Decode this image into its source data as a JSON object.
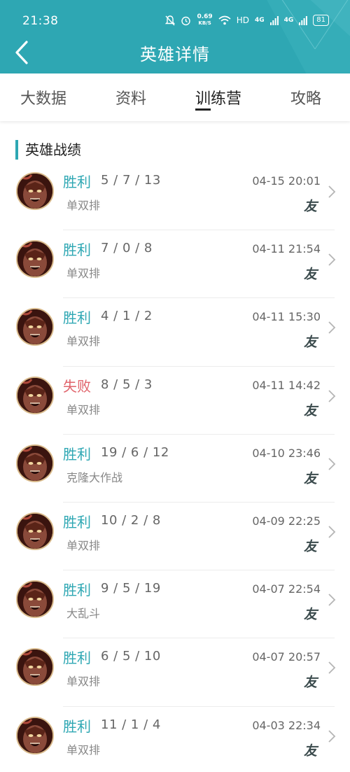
{
  "status": {
    "time": "21:38",
    "net_speed": "0.69",
    "net_unit": "KB/S",
    "hd": "HD",
    "sig1": "4G",
    "sig2": "4G",
    "battery": "81"
  },
  "header": {
    "title": "英雄详情"
  },
  "tabs": [
    {
      "label": "大数据",
      "active": false
    },
    {
      "label": "资料",
      "active": false
    },
    {
      "label": "训练营",
      "active": true
    },
    {
      "label": "攻略",
      "active": false
    }
  ],
  "section": {
    "title": "英雄战绩"
  },
  "colors": {
    "accent": "#2ea7b3",
    "win": "#2ea7b3",
    "lose": "#e0636b"
  },
  "matches": [
    {
      "result": "胜利",
      "kda": "5 / 7 / 13",
      "mode": "单双排",
      "time": "04-15 20:01",
      "tag": "友"
    },
    {
      "result": "胜利",
      "kda": "7 / 0 / 8",
      "mode": "单双排",
      "time": "04-11 21:54",
      "tag": "友"
    },
    {
      "result": "胜利",
      "kda": "4 / 1 / 2",
      "mode": "单双排",
      "time": "04-11 15:30",
      "tag": "友"
    },
    {
      "result": "失败",
      "kda": "8 / 5 / 3",
      "mode": "单双排",
      "time": "04-11 14:42",
      "tag": "友"
    },
    {
      "result": "胜利",
      "kda": "19 / 6 / 12",
      "mode": "克隆大作战",
      "time": "04-10 23:46",
      "tag": "友"
    },
    {
      "result": "胜利",
      "kda": "10 / 2 / 8",
      "mode": "单双排",
      "time": "04-09 22:25",
      "tag": "友"
    },
    {
      "result": "胜利",
      "kda": "9 / 5 / 19",
      "mode": "大乱斗",
      "time": "04-07 22:54",
      "tag": "友"
    },
    {
      "result": "胜利",
      "kda": "6 / 5 / 10",
      "mode": "单双排",
      "time": "04-07 20:57",
      "tag": "友"
    },
    {
      "result": "胜利",
      "kda": "11 / 1 / 4",
      "mode": "单双排",
      "time": "04-03 22:34",
      "tag": "友"
    }
  ]
}
